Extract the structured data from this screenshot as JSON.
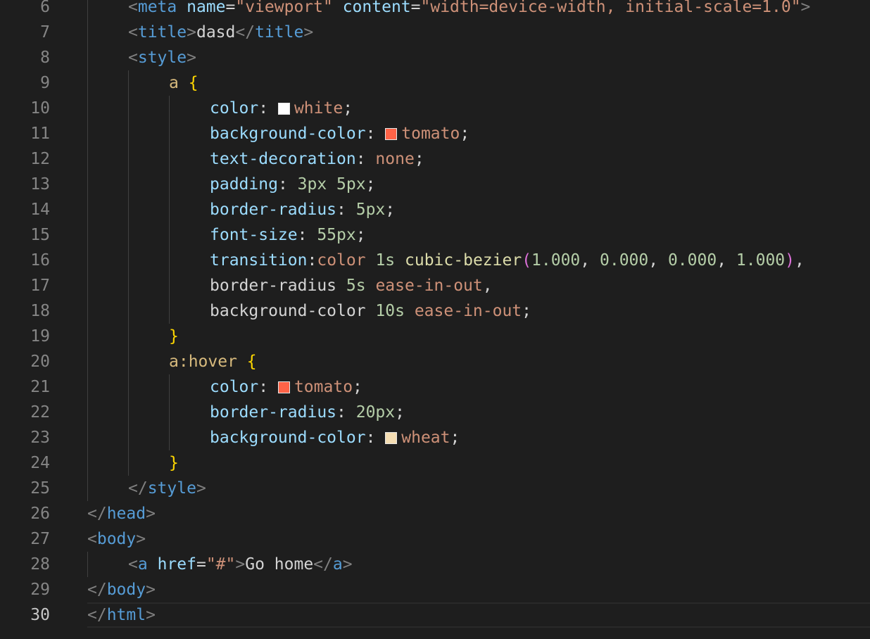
{
  "colors": {
    "background": "#1e1e1e",
    "line_number": "#858585",
    "line_number_current": "#c6c6c6",
    "tag": "#569cd6",
    "attr": "#9cdcfe",
    "string": "#ce9178",
    "selector": "#d7ba7d",
    "brace": "#ffd700",
    "number": "#b5cea8",
    "function": "#dcdcaa",
    "paren": "#da70d6"
  },
  "line_numbers": [
    "6",
    "7",
    "8",
    "9",
    "10",
    "11",
    "12",
    "13",
    "14",
    "15",
    "16",
    "17",
    "18",
    "19",
    "20",
    "21",
    "22",
    "23",
    "24",
    "25",
    "26",
    "27",
    "28",
    "29",
    "30"
  ],
  "current_line": "30",
  "code": {
    "l6": {
      "t1": "<",
      "t2": "meta",
      "t3": " ",
      "t4": "name",
      "t5": "=",
      "t6": "\"viewport\"",
      "t7": " ",
      "t8": "content",
      "t9": "=",
      "t10": "\"width=device-width, initial-scale=1.0\"",
      "t11": ">"
    },
    "l7": {
      "t1": "<",
      "t2": "title",
      "t3": ">",
      "t4": "dasd",
      "t5": "</",
      "t6": "title",
      "t7": ">"
    },
    "l8": {
      "t1": "<",
      "t2": "style",
      "t3": ">"
    },
    "l9": {
      "t1": "a",
      "t2": " ",
      "t3": "{"
    },
    "l10": {
      "t1": "color",
      "t2": ": ",
      "swatch": "#ffffff",
      "t3": "white",
      "t4": ";"
    },
    "l11": {
      "t1": "background-color",
      "t2": ": ",
      "swatch": "#ff6347",
      "t3": "tomato",
      "t4": ";"
    },
    "l12": {
      "t1": "text-decoration",
      "t2": ": ",
      "t3": "none",
      "t4": ";"
    },
    "l13": {
      "t1": "padding",
      "t2": ": ",
      "t3": "3px",
      "t4": " ",
      "t5": "5px",
      "t6": ";"
    },
    "l14": {
      "t1": "border-radius",
      "t2": ": ",
      "t3": "5px",
      "t4": ";"
    },
    "l15": {
      "t1": "font-size",
      "t2": ": ",
      "t3": "55px",
      "t4": ";"
    },
    "l16": {
      "t1": "transition",
      "t2": ":",
      "t3": "color",
      "t4": " ",
      "t5": "1s",
      "t6": " ",
      "t7": "cubic-bezier",
      "t8": "(",
      "t9": "1.000",
      "t10": ", ",
      "t11": "0.000",
      "t12": ", ",
      "t13": "0.000",
      "t14": ", ",
      "t15": "1.000",
      "t16": ")",
      "t17": ","
    },
    "l17": {
      "t1": "border-radius",
      "t2": " ",
      "t3": "5s",
      "t4": " ",
      "t5": "ease-in-out",
      "t6": ","
    },
    "l18": {
      "t1": "background-color",
      "t2": " ",
      "t3": "10s",
      "t4": " ",
      "t5": "ease-in-out",
      "t6": ";"
    },
    "l19": {
      "t1": "}"
    },
    "l20": {
      "t1": "a:hover",
      "t2": " ",
      "t3": "{"
    },
    "l21": {
      "t1": "color",
      "t2": ": ",
      "swatch": "#ff6347",
      "t3": "tomato",
      "t4": ";"
    },
    "l22": {
      "t1": "border-radius",
      "t2": ": ",
      "t3": "20px",
      "t4": ";"
    },
    "l23": {
      "t1": "background-color",
      "t2": ": ",
      "swatch": "#f5deb3",
      "t3": "wheat",
      "t4": ";"
    },
    "l24": {
      "t1": "}"
    },
    "l25": {
      "t1": "</",
      "t2": "style",
      "t3": ">"
    },
    "l26": {
      "t1": "</",
      "t2": "head",
      "t3": ">"
    },
    "l27": {
      "t1": "<",
      "t2": "body",
      "t3": ">"
    },
    "l28": {
      "t1": "<",
      "t2": "a",
      "t3": " ",
      "t4": "href",
      "t5": "=",
      "t6": "\"#\"",
      "t7": ">",
      "t8": "Go home",
      "t9": "</",
      "t10": "a",
      "t11": ">"
    },
    "l29": {
      "t1": "</",
      "t2": "body",
      "t3": ">"
    },
    "l30": {
      "t1": "</",
      "t2": "html",
      "t3": ">"
    }
  }
}
